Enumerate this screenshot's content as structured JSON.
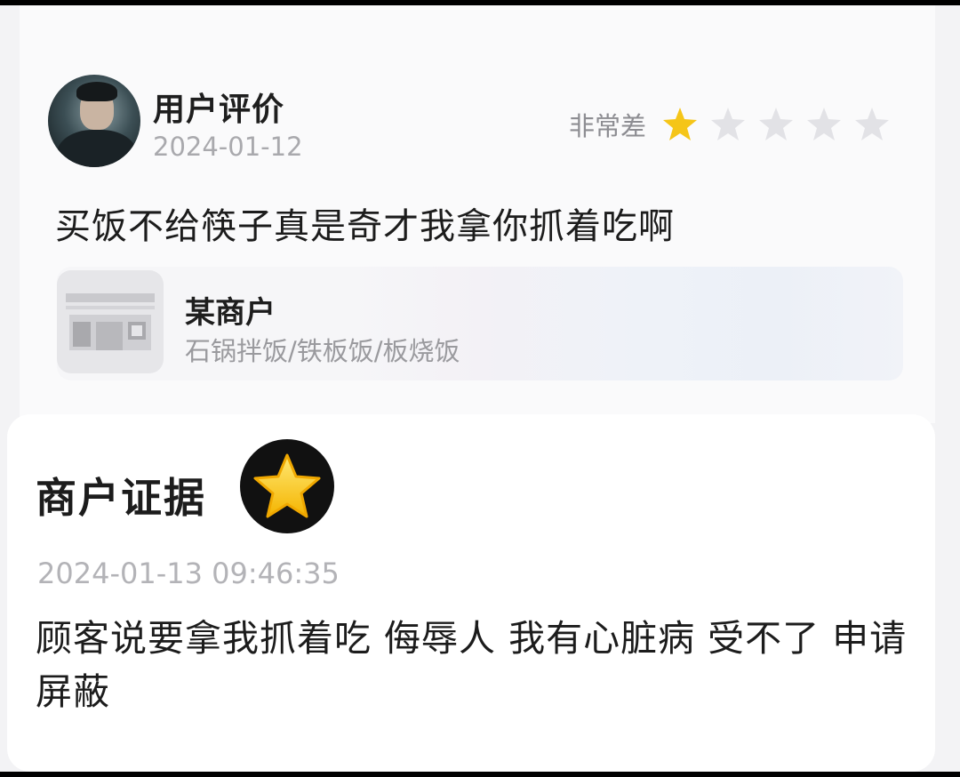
{
  "review": {
    "reviewer_name": "用户评价",
    "date": "2024-01-12",
    "rating_label": "非常差",
    "rating_value": 1,
    "rating_max": 5,
    "text": "买饭不给筷子真是奇才我拿你抓着吃啊"
  },
  "merchant": {
    "name": "某商户",
    "category": "石锅拌饭/铁板饭/板烧饭"
  },
  "evidence": {
    "title": "商户证据",
    "badge_icon": "star-emoji-icon",
    "timestamp": "2024-01-13 09:46:35",
    "text": "顾客说要拿我抓着吃 侮辱人 我有心脏病 受不了 申请屏蔽"
  },
  "colors": {
    "star_filled": "#f5c518",
    "star_empty": "#e2e2e6",
    "muted_text": "#a9a9ad"
  }
}
